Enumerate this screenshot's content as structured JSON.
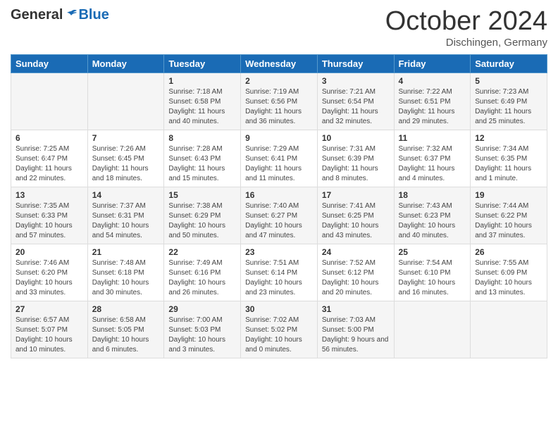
{
  "header": {
    "logo_general": "General",
    "logo_blue": "Blue",
    "month_title": "October 2024",
    "subtitle": "Dischingen, Germany"
  },
  "days_of_week": [
    "Sunday",
    "Monday",
    "Tuesday",
    "Wednesday",
    "Thursday",
    "Friday",
    "Saturday"
  ],
  "weeks": [
    [
      {
        "day": "",
        "info": ""
      },
      {
        "day": "",
        "info": ""
      },
      {
        "day": "1",
        "info": "Sunrise: 7:18 AM\nSunset: 6:58 PM\nDaylight: 11 hours and 40 minutes."
      },
      {
        "day": "2",
        "info": "Sunrise: 7:19 AM\nSunset: 6:56 PM\nDaylight: 11 hours and 36 minutes."
      },
      {
        "day": "3",
        "info": "Sunrise: 7:21 AM\nSunset: 6:54 PM\nDaylight: 11 hours and 32 minutes."
      },
      {
        "day": "4",
        "info": "Sunrise: 7:22 AM\nSunset: 6:51 PM\nDaylight: 11 hours and 29 minutes."
      },
      {
        "day": "5",
        "info": "Sunrise: 7:23 AM\nSunset: 6:49 PM\nDaylight: 11 hours and 25 minutes."
      }
    ],
    [
      {
        "day": "6",
        "info": "Sunrise: 7:25 AM\nSunset: 6:47 PM\nDaylight: 11 hours and 22 minutes."
      },
      {
        "day": "7",
        "info": "Sunrise: 7:26 AM\nSunset: 6:45 PM\nDaylight: 11 hours and 18 minutes."
      },
      {
        "day": "8",
        "info": "Sunrise: 7:28 AM\nSunset: 6:43 PM\nDaylight: 11 hours and 15 minutes."
      },
      {
        "day": "9",
        "info": "Sunrise: 7:29 AM\nSunset: 6:41 PM\nDaylight: 11 hours and 11 minutes."
      },
      {
        "day": "10",
        "info": "Sunrise: 7:31 AM\nSunset: 6:39 PM\nDaylight: 11 hours and 8 minutes."
      },
      {
        "day": "11",
        "info": "Sunrise: 7:32 AM\nSunset: 6:37 PM\nDaylight: 11 hours and 4 minutes."
      },
      {
        "day": "12",
        "info": "Sunrise: 7:34 AM\nSunset: 6:35 PM\nDaylight: 11 hours and 1 minute."
      }
    ],
    [
      {
        "day": "13",
        "info": "Sunrise: 7:35 AM\nSunset: 6:33 PM\nDaylight: 10 hours and 57 minutes."
      },
      {
        "day": "14",
        "info": "Sunrise: 7:37 AM\nSunset: 6:31 PM\nDaylight: 10 hours and 54 minutes."
      },
      {
        "day": "15",
        "info": "Sunrise: 7:38 AM\nSunset: 6:29 PM\nDaylight: 10 hours and 50 minutes."
      },
      {
        "day": "16",
        "info": "Sunrise: 7:40 AM\nSunset: 6:27 PM\nDaylight: 10 hours and 47 minutes."
      },
      {
        "day": "17",
        "info": "Sunrise: 7:41 AM\nSunset: 6:25 PM\nDaylight: 10 hours and 43 minutes."
      },
      {
        "day": "18",
        "info": "Sunrise: 7:43 AM\nSunset: 6:23 PM\nDaylight: 10 hours and 40 minutes."
      },
      {
        "day": "19",
        "info": "Sunrise: 7:44 AM\nSunset: 6:22 PM\nDaylight: 10 hours and 37 minutes."
      }
    ],
    [
      {
        "day": "20",
        "info": "Sunrise: 7:46 AM\nSunset: 6:20 PM\nDaylight: 10 hours and 33 minutes."
      },
      {
        "day": "21",
        "info": "Sunrise: 7:48 AM\nSunset: 6:18 PM\nDaylight: 10 hours and 30 minutes."
      },
      {
        "day": "22",
        "info": "Sunrise: 7:49 AM\nSunset: 6:16 PM\nDaylight: 10 hours and 26 minutes."
      },
      {
        "day": "23",
        "info": "Sunrise: 7:51 AM\nSunset: 6:14 PM\nDaylight: 10 hours and 23 minutes."
      },
      {
        "day": "24",
        "info": "Sunrise: 7:52 AM\nSunset: 6:12 PM\nDaylight: 10 hours and 20 minutes."
      },
      {
        "day": "25",
        "info": "Sunrise: 7:54 AM\nSunset: 6:10 PM\nDaylight: 10 hours and 16 minutes."
      },
      {
        "day": "26",
        "info": "Sunrise: 7:55 AM\nSunset: 6:09 PM\nDaylight: 10 hours and 13 minutes."
      }
    ],
    [
      {
        "day": "27",
        "info": "Sunrise: 6:57 AM\nSunset: 5:07 PM\nDaylight: 10 hours and 10 minutes."
      },
      {
        "day": "28",
        "info": "Sunrise: 6:58 AM\nSunset: 5:05 PM\nDaylight: 10 hours and 6 minutes."
      },
      {
        "day": "29",
        "info": "Sunrise: 7:00 AM\nSunset: 5:03 PM\nDaylight: 10 hours and 3 minutes."
      },
      {
        "day": "30",
        "info": "Sunrise: 7:02 AM\nSunset: 5:02 PM\nDaylight: 10 hours and 0 minutes."
      },
      {
        "day": "31",
        "info": "Sunrise: 7:03 AM\nSunset: 5:00 PM\nDaylight: 9 hours and 56 minutes."
      },
      {
        "day": "",
        "info": ""
      },
      {
        "day": "",
        "info": ""
      }
    ]
  ]
}
